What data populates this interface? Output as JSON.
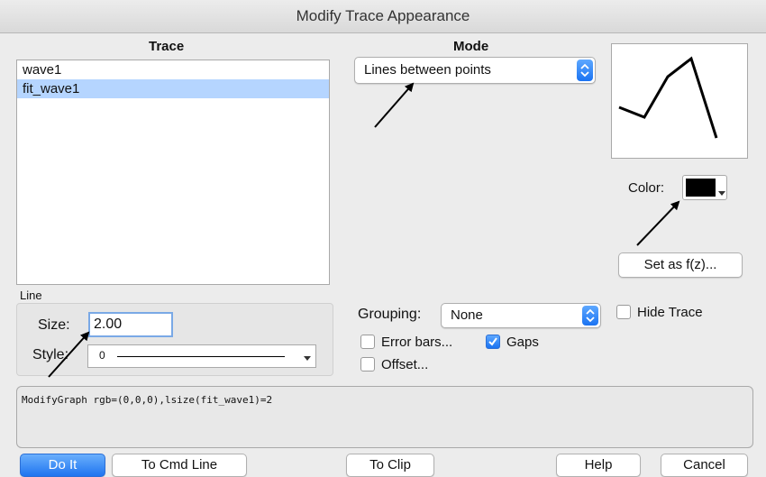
{
  "window": {
    "title": "Modify Trace Appearance"
  },
  "trace": {
    "heading": "Trace",
    "items": [
      {
        "label": "wave1",
        "selected": false
      },
      {
        "label": "fit_wave1",
        "selected": true
      }
    ]
  },
  "mode": {
    "heading": "Mode",
    "value": "Lines between points"
  },
  "color": {
    "label": "Color:",
    "value": "#000000"
  },
  "set_fz": {
    "label": "Set as f(z)..."
  },
  "line": {
    "heading": "Line",
    "size_label": "Size:",
    "size_value": "2.00",
    "style_label": "Style:",
    "style_value": "0"
  },
  "grouping": {
    "label": "Grouping:",
    "value": "None"
  },
  "hide_trace": {
    "label": "Hide Trace",
    "checked": false
  },
  "error_bars": {
    "label": "Error bars...",
    "checked": false
  },
  "gaps": {
    "label": "Gaps",
    "checked": true
  },
  "offset": {
    "label": "Offset...",
    "checked": false
  },
  "command": "ModifyGraph rgb=(0,0,0),lsize(fit_wave1)=2",
  "buttons": {
    "do_it": "Do It",
    "to_cmd_line": "To Cmd Line",
    "to_clip": "To Clip",
    "help": "Help",
    "cancel": "Cancel"
  }
}
